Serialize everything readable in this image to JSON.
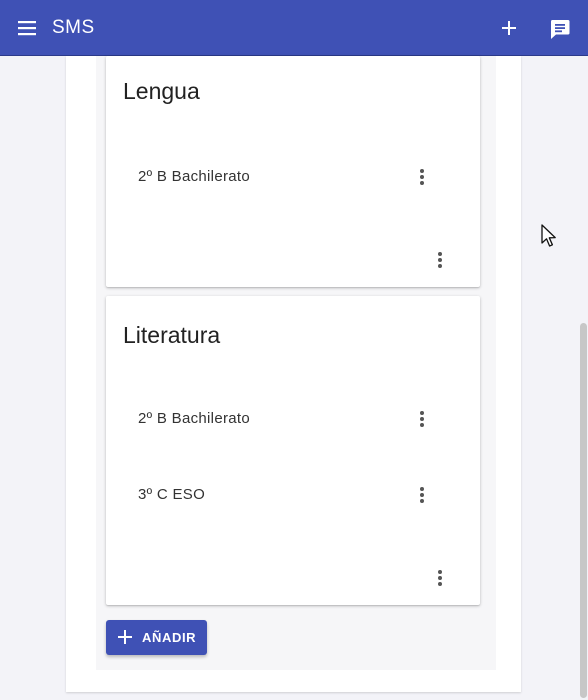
{
  "app": {
    "title": "SMS",
    "brand_color": "#3f51b5",
    "menu_icon": "menu-icon",
    "add_icon": "plus-icon",
    "messages_icon": "message-icon"
  },
  "subjects": [
    {
      "title": "Lengua",
      "classes": [
        {
          "label": "2º B Bachilerato"
        }
      ]
    },
    {
      "title": "Literatura",
      "classes": [
        {
          "label": "2º B Bachilerato"
        },
        {
          "label": "3º C ESO"
        }
      ]
    }
  ],
  "actions": {
    "add_label": "AÑADIR"
  }
}
